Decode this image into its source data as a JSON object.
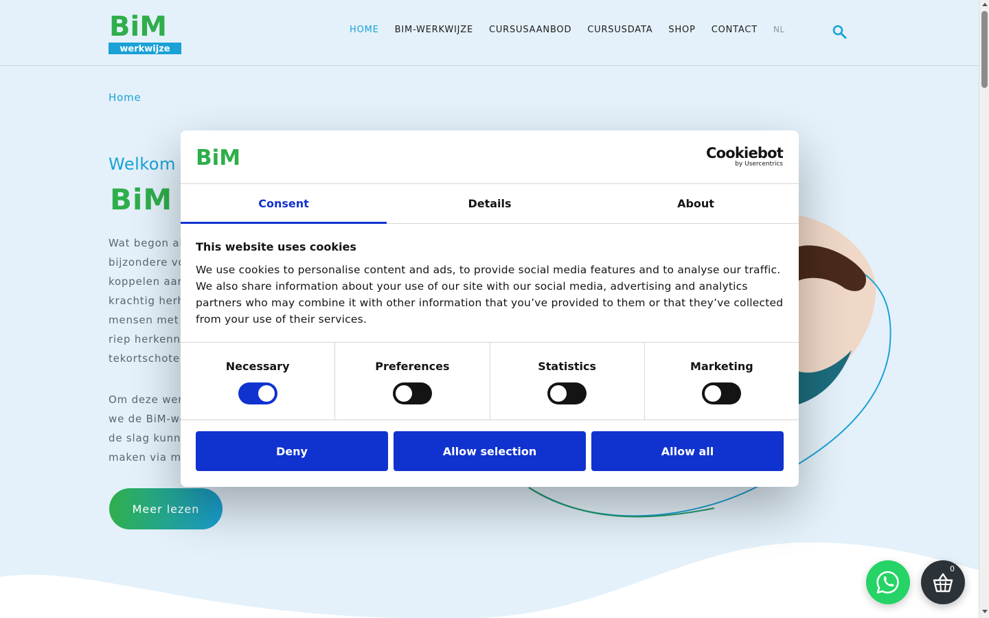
{
  "header": {
    "logo_top": "BiM",
    "logo_bottom": "werkwijze",
    "nav": [
      {
        "label": "HOME",
        "active": true
      },
      {
        "label": "BIM-WERKWIJZE",
        "active": false
      },
      {
        "label": "CURSUSAANBOD",
        "active": false
      },
      {
        "label": "CURSUSDATA",
        "active": false
      },
      {
        "label": "SHOP",
        "active": false
      },
      {
        "label": "CONTACT",
        "active": false
      }
    ],
    "language": "NL"
  },
  "page": {
    "breadcrumb": "Home",
    "welcome": "Welkom",
    "title": "BiM -",
    "paragraph1": [
      "Wat begon al",
      "bijzondere vo",
      "koppelen aan",
      "krachtig herh",
      "mensen met e",
      "riep herkenni",
      "tekortschoten"
    ],
    "paragraph2": [
      "Om deze wer",
      "we de BiM-we",
      "de slag kunne",
      "maken via mu"
    ],
    "cta_label": "Meer lezen"
  },
  "cart": {
    "count": "0"
  },
  "cookie_dialog": {
    "brand_name": "Cookiebot",
    "brand_sub": "by Usercentrics",
    "logo_text": "BiM",
    "tabs": [
      {
        "label": "Consent",
        "active": true
      },
      {
        "label": "Details",
        "active": false
      },
      {
        "label": "About",
        "active": false
      }
    ],
    "title": "This website uses cookies",
    "text": "We use cookies to personalise content and ads, to provide social media features and to analyse our traffic. We also share information about your use of our site with our social media, advertising and analytics partners who may combine it with other information that you’ve provided to them or that they’ve collected from your use of their services.",
    "toggles": [
      {
        "label": "Necessary",
        "checked": true
      },
      {
        "label": "Preferences",
        "checked": false
      },
      {
        "label": "Statistics",
        "checked": false
      },
      {
        "label": "Marketing",
        "checked": false
      }
    ],
    "buttons": {
      "deny": "Deny",
      "allow_selection": "Allow selection",
      "allow_all": "Allow all"
    }
  },
  "colors": {
    "accent_blue": "#1aa1d6",
    "brand_green": "#2fae4b",
    "dialog_blue": "#1032cf",
    "whatsapp_green": "#25d366"
  }
}
